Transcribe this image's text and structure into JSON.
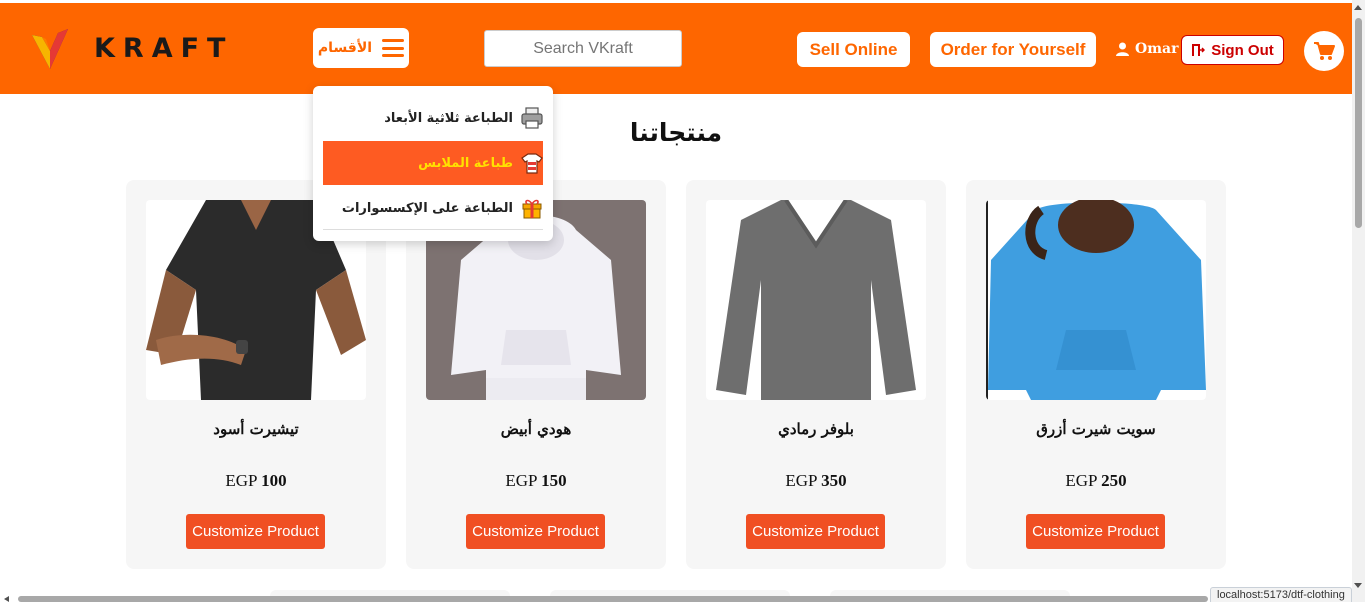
{
  "header": {
    "logo_text": "KRAFT",
    "categories_label": "الأقسام",
    "search_placeholder": "Search VKraft",
    "sell_online": "Sell Online",
    "order_yourself": "Order for Yourself",
    "user_name": "Omar",
    "sign_out": "Sign Out"
  },
  "dropdown": {
    "items": [
      {
        "label": "الطباعة ثلاثية الأبعاد",
        "icon": "printer-icon",
        "active": false
      },
      {
        "label": "طباعة الملابس",
        "icon": "tshirt-icon",
        "active": true
      },
      {
        "label": "الطباعة على الإكسسوارات",
        "icon": "gift-icon",
        "active": false
      }
    ]
  },
  "section_title": "منتجاتنا",
  "products": [
    {
      "name": "تيشيرت أسود",
      "currency": "EGP",
      "price": "100",
      "button": "Customize Product"
    },
    {
      "name": "هودي أبيض",
      "currency": "EGP",
      "price": "150",
      "button": "Customize Product"
    },
    {
      "name": "بلوفر رمادي",
      "currency": "EGP",
      "price": "350",
      "button": "Customize Product"
    },
    {
      "name": "سويت شيرت أزرق",
      "currency": "EGP",
      "price": "250",
      "button": "Customize Product"
    }
  ],
  "status_url": "localhost:5173/dtf-clothing",
  "colors": {
    "brand_orange": "#fe6600",
    "button_orange": "#f04f23",
    "active_item_text": "#ffe100",
    "sign_out_red": "#cc0000"
  }
}
